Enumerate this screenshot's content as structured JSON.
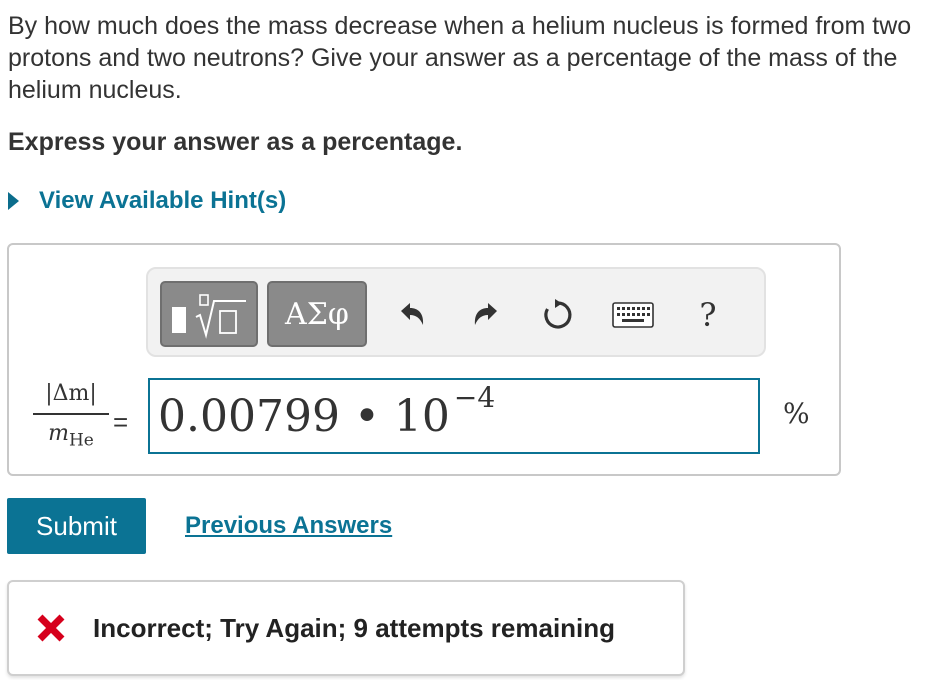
{
  "question": {
    "text": "By how much does the mass decrease when a helium nucleus is formed from two protons and two neutrons? Give your answer as a percentage of the mass of the helium nucleus.",
    "instruction": "Express your answer as a percentage."
  },
  "hint": {
    "label": "View Available Hint(s)"
  },
  "toolbar": {
    "greek_label": "ΑΣφ",
    "help_label": "?",
    "icons": [
      "templates-icon",
      "undo-icon",
      "redo-icon",
      "reset-icon",
      "keyboard-icon",
      "help-icon"
    ]
  },
  "answer": {
    "lhs_numerator": "|Δm|",
    "lhs_denominator_var": "m",
    "lhs_denominator_sub": "He",
    "equals": "=",
    "value_mantissa": "0.00799 • 10",
    "value_exponent": "−4",
    "unit": "%"
  },
  "actions": {
    "submit_label": "Submit",
    "previous_answers_label": "Previous Answers"
  },
  "feedback": {
    "text": "Incorrect; Try Again; 9 attempts remaining",
    "status_color": "#d6001c"
  },
  "colors": {
    "accent": "#0b7394",
    "text": "#333333",
    "error": "#d6001c"
  }
}
